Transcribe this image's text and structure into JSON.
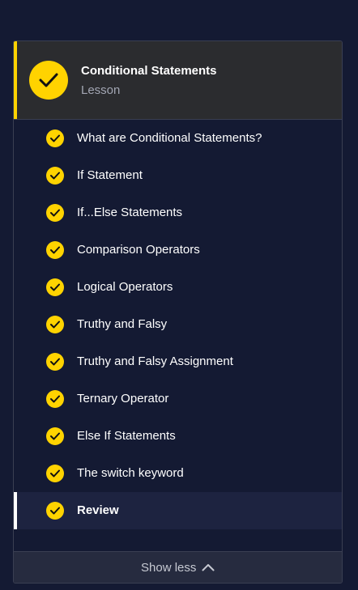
{
  "lesson": {
    "title": "Conditional Statements",
    "type_label": "Lesson"
  },
  "items": [
    {
      "label": "What are Conditional Statements?"
    },
    {
      "label": "If Statement"
    },
    {
      "label": "If...Else Statements"
    },
    {
      "label": "Comparison Operators"
    },
    {
      "label": "Logical Operators"
    },
    {
      "label": "Truthy and Falsy"
    },
    {
      "label": "Truthy and Falsy Assignment"
    },
    {
      "label": "Ternary Operator"
    },
    {
      "label": "Else If Statements"
    },
    {
      "label": "The switch keyword"
    },
    {
      "label": "Review"
    }
  ],
  "footer": {
    "toggle_label": "Show less"
  },
  "icons": {
    "status": "check-icon",
    "toggle": "chevron-up-icon"
  },
  "colors": {
    "accent": "#ffd300",
    "background": "#141a33",
    "header_bg": "#2b2c2f"
  }
}
